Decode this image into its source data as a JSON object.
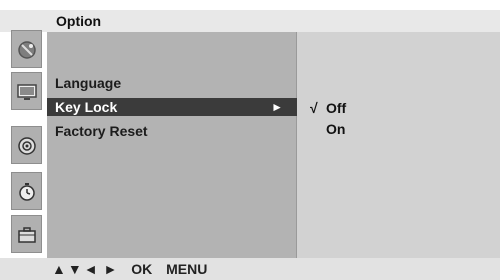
{
  "header": {
    "title": "Option"
  },
  "sidebar_icons": [
    {
      "name": "satellite-dish-icon"
    },
    {
      "name": "tv-monitor-icon"
    },
    {
      "name": "speaker-icon"
    },
    {
      "name": "clock-icon"
    },
    {
      "name": "briefcase-icon"
    }
  ],
  "menu": {
    "items": [
      {
        "label": "Language",
        "selected": false
      },
      {
        "label": "Key Lock",
        "selected": true
      },
      {
        "label": "Factory Reset",
        "selected": false
      }
    ],
    "selected_arrow": "►"
  },
  "options": {
    "check_mark": "√",
    "items": [
      {
        "label": "Off",
        "checked": true
      },
      {
        "label": "On",
        "checked": false
      }
    ]
  },
  "footer": {
    "nav_up": "▲",
    "nav_down": "▼",
    "nav_left": "◄",
    "nav_right": "►",
    "ok_label": "OK",
    "menu_label": "MENU"
  },
  "colors": {
    "selected_bg": "#3b3b3b",
    "menu_panel_bg": "#b3b3b3",
    "options_panel_bg": "#d2d2d2",
    "header_bg": "#e8e8e8"
  }
}
